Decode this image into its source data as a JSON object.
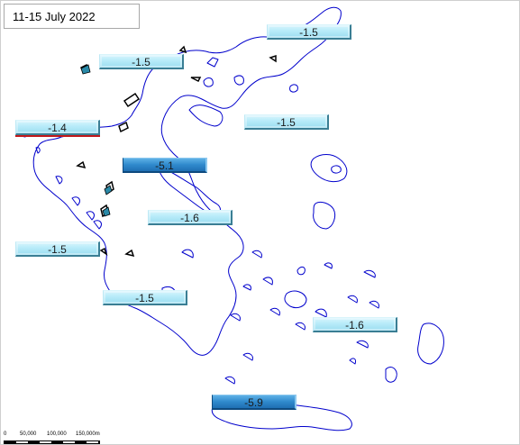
{
  "header": {
    "date_label": "11-15  July 2022"
  },
  "temperature_anomalies": [
    {
      "value": "-1.5",
      "style": "light"
    },
    {
      "value": "-1.5",
      "style": "light"
    },
    {
      "value": "-1.4",
      "style": "light"
    },
    {
      "value": "-1.5",
      "style": "light"
    },
    {
      "value": "-5.1",
      "style": "dark"
    },
    {
      "value": "-1.6",
      "style": "light"
    },
    {
      "value": "-1.5",
      "style": "light"
    },
    {
      "value": "-1.5",
      "style": "light"
    },
    {
      "value": "-1.6",
      "style": "light"
    },
    {
      "value": "-5.9",
      "style": "dark"
    }
  ],
  "scale_bar": {
    "labels": [
      "0",
      "50,000",
      "100,000",
      "150,000m"
    ]
  },
  "colors": {
    "coastline": "#0000cc",
    "badge_light": "#b7ebf9",
    "badge_dark": "#2f89cc",
    "highlight_line": "#c0181a"
  }
}
